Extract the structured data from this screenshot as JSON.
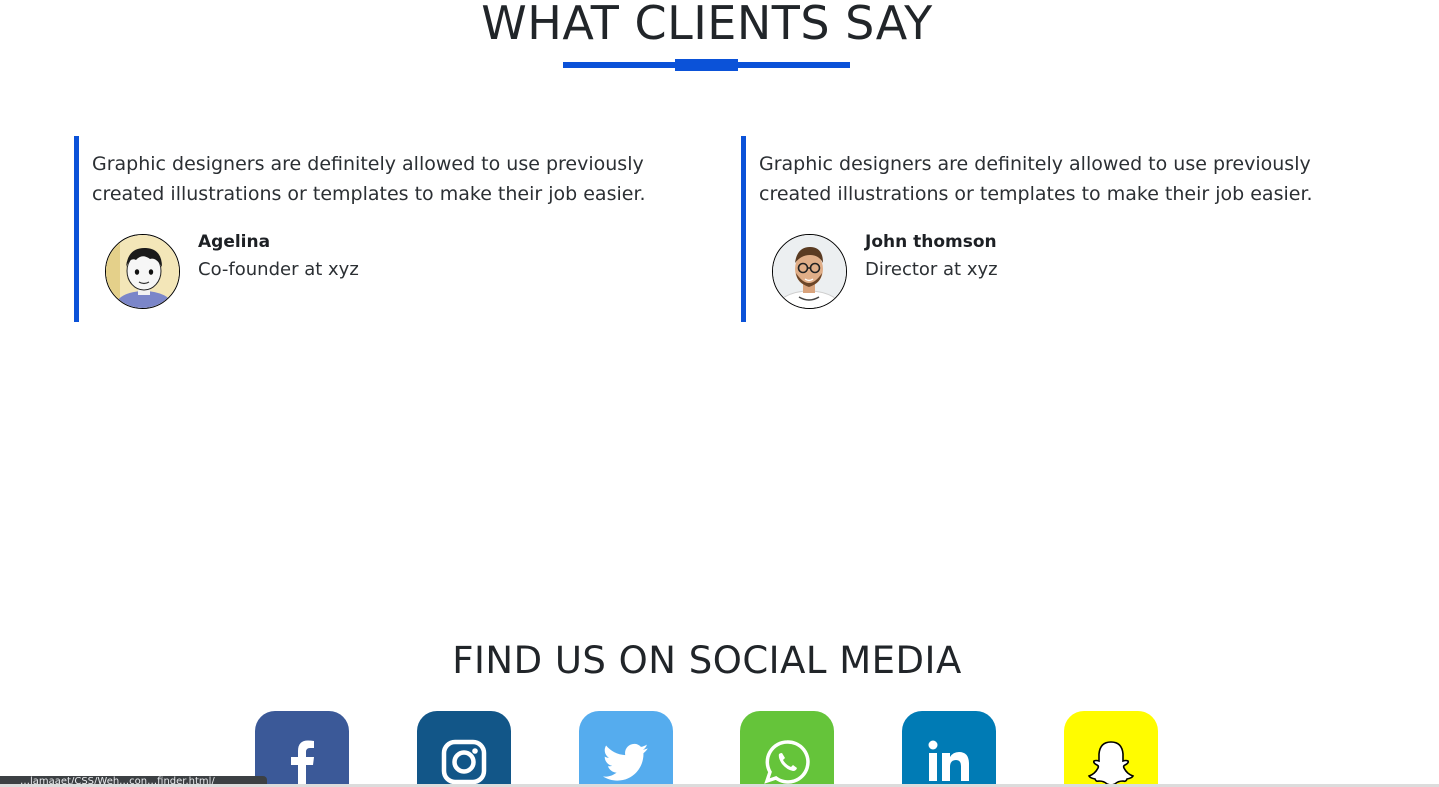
{
  "testimonials_section": {
    "title": "WHAT CLIENTS SAY",
    "accent_color": "#0b52d8",
    "testimonials": [
      {
        "quote": "Graphic designers are definitely allowed to use previously created illustrations or templates to make their job easier.",
        "name": "Agelina",
        "role": "Co-founder at xyz",
        "avatar": "cartoon-girl-avatar"
      },
      {
        "quote": "Graphic designers are definitely allowed to use previously created illustrations or templates to make their job easier.",
        "name": "John thomson",
        "role": "Director at xyz",
        "avatar": "man-with-glasses-avatar"
      }
    ]
  },
  "social_section": {
    "title": "FIND US ON SOCIAL MEDIA",
    "links": [
      {
        "name": "facebook",
        "icon": "facebook-icon",
        "color": "#3b5998"
      },
      {
        "name": "instagram",
        "icon": "instagram-icon",
        "color": "#125688"
      },
      {
        "name": "twitter",
        "icon": "twitter-icon",
        "color": "#55acee"
      },
      {
        "name": "whatsapp",
        "icon": "whatsapp-icon",
        "color": "#65c43a"
      },
      {
        "name": "linkedin",
        "icon": "linkedin-icon",
        "color": "#007bb5"
      },
      {
        "name": "snapchat",
        "icon": "snapchat-icon",
        "color": "#fffc00"
      }
    ]
  },
  "status_bar": {
    "text": "…lamaaet/CSS/Weh…con…finder.html/"
  }
}
